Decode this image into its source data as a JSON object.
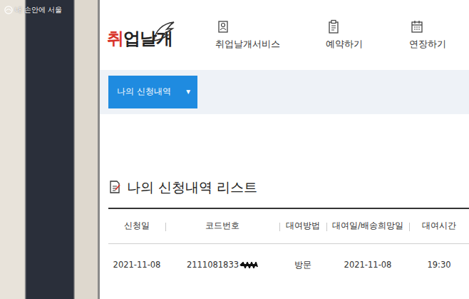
{
  "watermark": "내 손안에 서울",
  "logo": {
    "text": "취업날개"
  },
  "nav": {
    "items": [
      {
        "label": "취업날개서비스"
      },
      {
        "label": "예약하기"
      },
      {
        "label": "연장하기"
      }
    ]
  },
  "dropdown": {
    "label": "나의 신청내역",
    "caret": "▾"
  },
  "list": {
    "title": "나의 신청내역 리스트"
  },
  "table": {
    "columns": [
      "신청일",
      "코드번호",
      "대여방법",
      "대여일/배송희망일",
      "대여시간"
    ],
    "rows": [
      [
        "2021-11-08",
        "2111081833",
        "방문",
        "2021-11-08",
        "19:30"
      ]
    ]
  }
}
